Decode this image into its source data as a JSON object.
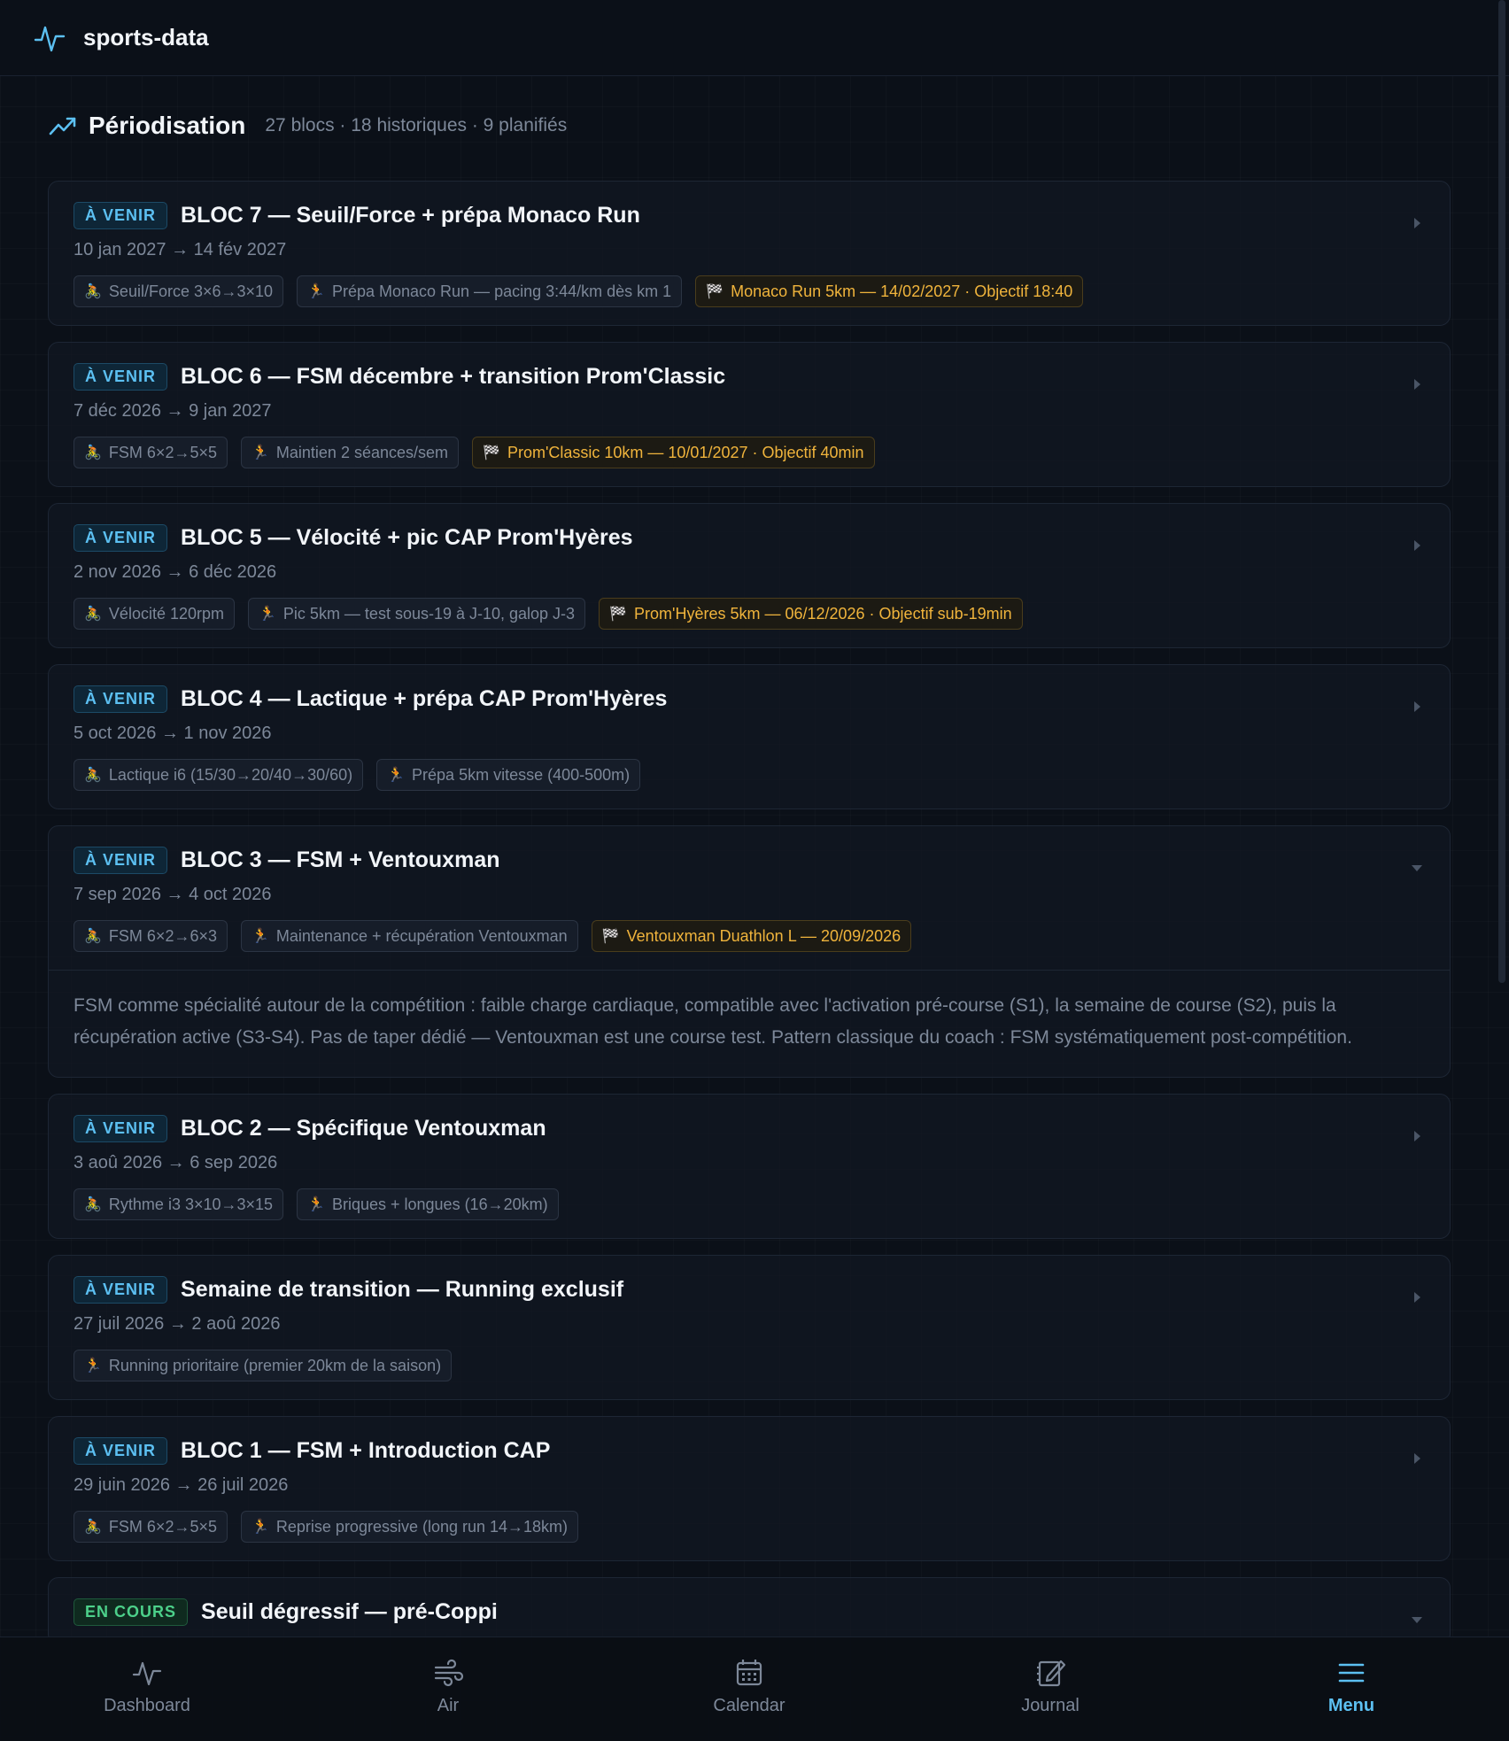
{
  "app": {
    "name": "sports-data"
  },
  "section": {
    "title": "Périodisation",
    "subtitle": "27 blocs · 18 historiques · 9 planifiés"
  },
  "colors": {
    "accent": "#5cc0f2",
    "race": "#f0b43c",
    "current": "#4cd08a"
  },
  "blocks": [
    {
      "status": "À VENIR",
      "title": "BLOC 7 — Seuil/Force + prépa Monaco Run",
      "dates": "10 jan 2027 → 14 fév 2027",
      "tags": [
        {
          "icon": "cyclist-icon",
          "glyph": "🚴",
          "label": "Seuil/Force 3×6→3×10",
          "race": false
        },
        {
          "icon": "runner-icon",
          "glyph": "🏃",
          "label": "Prépa Monaco Run — pacing 3:44/km dès km 1",
          "race": false
        },
        {
          "icon": "checkered-flag-icon",
          "glyph": "🏁",
          "label": "Monaco Run 5km — 14/02/2027 · Objectif 18:40",
          "race": true
        }
      ]
    },
    {
      "status": "À VENIR",
      "title": "BLOC 6 — FSM décembre + transition Prom'Classic",
      "dates": "7 déc 2026 → 9 jan 2027",
      "tags": [
        {
          "icon": "cyclist-icon",
          "glyph": "🚴",
          "label": "FSM 6×2→5×5",
          "race": false
        },
        {
          "icon": "runner-icon",
          "glyph": "🏃",
          "label": "Maintien 2 séances/sem",
          "race": false
        },
        {
          "icon": "checkered-flag-icon",
          "glyph": "🏁",
          "label": "Prom'Classic 10km — 10/01/2027 · Objectif 40min",
          "race": true
        }
      ]
    },
    {
      "status": "À VENIR",
      "title": "BLOC 5 — Vélocité + pic CAP Prom'Hyères",
      "dates": "2 nov 2026 → 6 déc 2026",
      "tags": [
        {
          "icon": "cyclist-icon",
          "glyph": "🚴",
          "label": "Vélocité 120rpm",
          "race": false
        },
        {
          "icon": "runner-icon",
          "glyph": "🏃",
          "label": "Pic 5km — test sous-19 à J-10, galop J-3",
          "race": false
        },
        {
          "icon": "checkered-flag-icon",
          "glyph": "🏁",
          "label": "Prom'Hyères 5km — 06/12/2026 · Objectif sub-19min",
          "race": true
        }
      ]
    },
    {
      "status": "À VENIR",
      "title": "BLOC 4 — Lactique + prépa CAP Prom'Hyères",
      "dates": "5 oct 2026 → 1 nov 2026",
      "tags": [
        {
          "icon": "cyclist-icon",
          "glyph": "🚴",
          "label": "Lactique i6 (15/30→20/40→30/60)",
          "race": false
        },
        {
          "icon": "runner-icon",
          "glyph": "🏃",
          "label": "Prépa 5km vitesse (400-500m)",
          "race": false
        }
      ]
    },
    {
      "status": "À VENIR",
      "title": "BLOC 3 — FSM + Ventouxman",
      "dates": "7 sep 2026 → 4 oct 2026",
      "expanded": true,
      "description": "FSM comme spécialité autour de la compétition : faible charge cardiaque, compatible avec l'activation pré-course (S1), la semaine de course (S2), puis la récupération active (S3-S4). Pas de taper dédié — Ventouxman est une course test. Pattern classique du coach : FSM systématiquement post-compétition.",
      "tags": [
        {
          "icon": "cyclist-icon",
          "glyph": "🚴",
          "label": "FSM 6×2→6×3",
          "race": false
        },
        {
          "icon": "runner-icon",
          "glyph": "🏃",
          "label": "Maintenance + récupération Ventouxman",
          "race": false
        },
        {
          "icon": "checkered-flag-icon",
          "glyph": "🏁",
          "label": "Ventouxman Duathlon L — 20/09/2026",
          "race": true
        }
      ]
    },
    {
      "status": "À VENIR",
      "title": "BLOC 2 — Spécifique Ventouxman",
      "dates": "3 aoû 2026 → 6 sep 2026",
      "tags": [
        {
          "icon": "cyclist-icon",
          "glyph": "🚴",
          "label": "Rythme i3 3×10→3×15",
          "race": false
        },
        {
          "icon": "runner-icon",
          "glyph": "🏃",
          "label": "Briques + longues (16→20km)",
          "race": false
        }
      ]
    },
    {
      "status": "À VENIR",
      "title": "Semaine de transition — Running exclusif",
      "dates": "27 juil 2026 → 2 aoû 2026",
      "tags": [
        {
          "icon": "runner-icon",
          "glyph": "🏃",
          "label": "Running prioritaire (premier 20km de la saison)",
          "race": false
        }
      ]
    },
    {
      "status": "À VENIR",
      "title": "BLOC 1 — FSM + Introduction CAP",
      "dates": "29 juin 2026 → 26 juil 2026",
      "tags": [
        {
          "icon": "cyclist-icon",
          "glyph": "🚴",
          "label": "FSM 6×2→5×5",
          "race": false
        },
        {
          "icon": "runner-icon",
          "glyph": "🏃",
          "label": "Reprise progressive (long run 14→18km)",
          "race": false
        }
      ]
    },
    {
      "status": "EN COURS",
      "current": true,
      "expanded": true,
      "title": "Seuil dégressif — pré-Coppi",
      "dates": "",
      "tags": []
    }
  ],
  "nav": [
    {
      "id": "dashboard",
      "label": "Dashboard",
      "icon": "pulse-icon",
      "active": false
    },
    {
      "id": "air",
      "label": "Air",
      "icon": "wind-icon",
      "active": false
    },
    {
      "id": "calendar",
      "label": "Calendar",
      "icon": "calendar-icon",
      "active": false
    },
    {
      "id": "journal",
      "label": "Journal",
      "icon": "journal-edit-icon",
      "active": false
    },
    {
      "id": "menu",
      "label": "Menu",
      "icon": "menu-icon",
      "active": true
    }
  ]
}
